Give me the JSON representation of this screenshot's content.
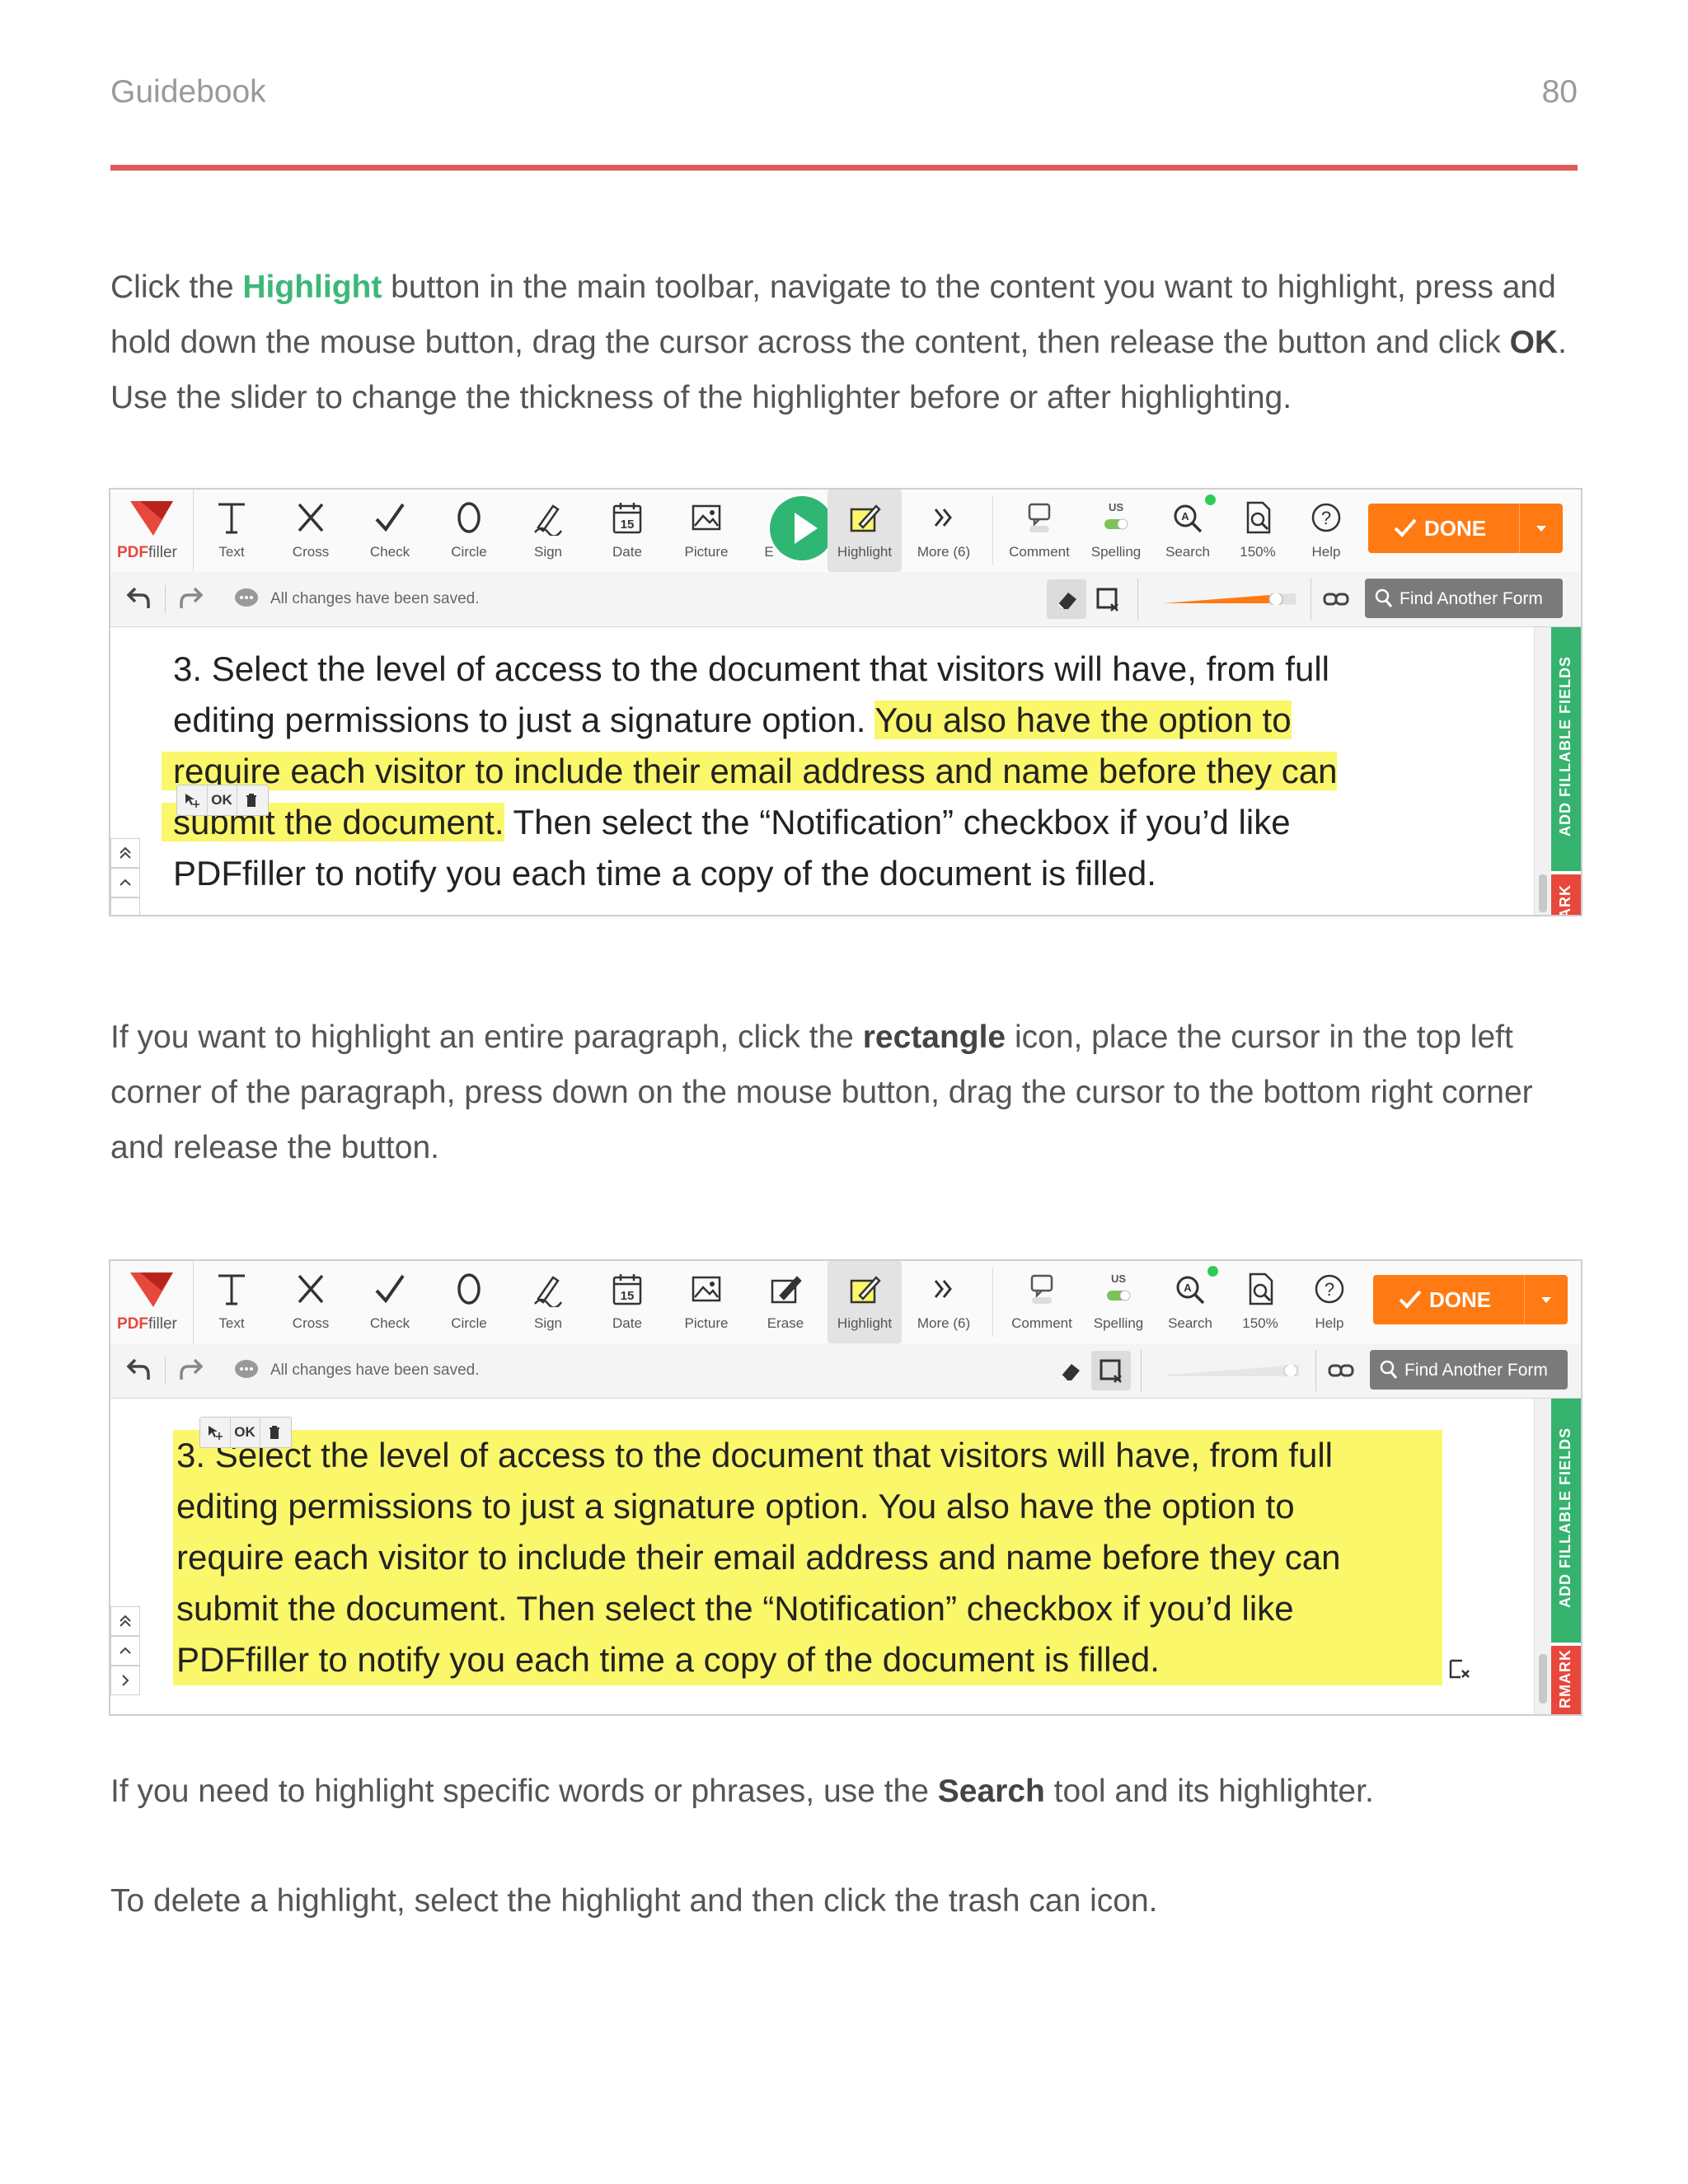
{
  "header": {
    "title": "Guidebook",
    "page_number": "80"
  },
  "para1": {
    "before": "Click the ",
    "bold1": "Highlight",
    "middle": " button in the main toolbar, navigate to the content you want to highlight, press and hold down the mouse button, drag the cursor across the content, then release the button and click ",
    "bold2": "OK",
    "after": ". Use the slider to change the thickness of the highlighter before or after highlighting."
  },
  "para2": {
    "before": "If you want to highlight an entire paragraph, click the ",
    "bold": "rectangle",
    "after": " icon, place the cursor in the top left corner of the paragraph, press down on the mouse button, drag the cursor to the bottom right corner and release the button."
  },
  "para3": {
    "before": "If you need to highlight specific words or phrases, use the ",
    "bold": "Search",
    "after": " tool and its highlighter."
  },
  "para4": {
    "text": "To delete a highlight, select the highlight and then click the trash can icon."
  },
  "app": {
    "logo_brand": "PDF",
    "logo_suffix": "filler",
    "tools1": [
      "Text",
      "Cross",
      "Check",
      "Circle",
      "Sign",
      "Date",
      "Picture",
      "E",
      "Highlight",
      "More (6)"
    ],
    "tools2": [
      "Text",
      "Cross",
      "Check",
      "Circle",
      "Sign",
      "Date",
      "Picture",
      "Erase",
      "Highlight",
      "More (6)"
    ],
    "right_tools": [
      "Comment",
      "Spelling",
      "Search",
      "150%",
      "Help"
    ],
    "spelling_tag": "US",
    "date_day": "15",
    "done_label": "DONE",
    "saved_status": "All changes have been saved.",
    "find_label": "Find Another Form",
    "ok_label": "OK",
    "side_green_label": "ADD FILLABLE FIELDS",
    "side_red_label1": "ARK",
    "side_red_label2": "RMARK"
  },
  "shot1_text": {
    "l1": "3. Select the level of access to the document that visitors will have, from full",
    "l2a": "editing permissions to just a signature option. ",
    "l2b": "You also have the option to",
    "l3": "require each visitor to include their email address and name before they can",
    "l4a": "submit the document.",
    "l4b": " Then select the “Notification” checkbox if you’d like",
    "l5": "PDFfiller to notify you each time a copy of the document is filled."
  },
  "shot2_text": {
    "l1": "3. Select the level of access to the document that visitors will have, from full",
    "l2": "editing permissions to just a signature option. You also have the option to",
    "l3": "require each visitor to include their email address and name before they can",
    "l4": "submit the document. Then select the “Notification” checkbox if you’d like",
    "l5": "PDFfiller to notify you each time a copy of the document is filled."
  },
  "colors": {
    "accent_green": "#3cb878",
    "rule_red": "#e05a5a",
    "done_orange": "#ff7a12",
    "highlight_yellow": "#fbf76a"
  }
}
